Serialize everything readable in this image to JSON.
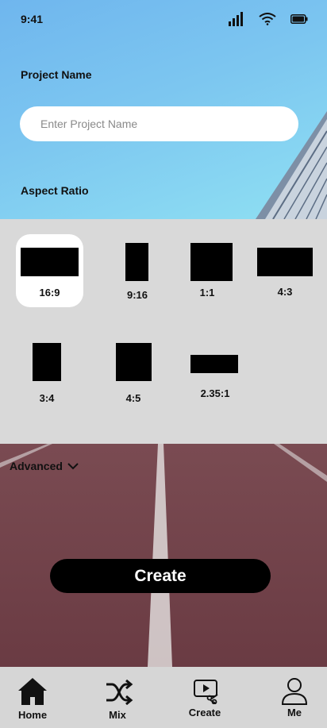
{
  "status": {
    "time": "9:41"
  },
  "form": {
    "project_name_label": "Project Name",
    "project_name_placeholder": "Enter Project Name",
    "aspect_ratio_label": "Aspect Ratio"
  },
  "aspect_ratios": [
    {
      "label": "16:9",
      "selected": true
    },
    {
      "label": "9:16",
      "selected": false
    },
    {
      "label": "1:1",
      "selected": false
    },
    {
      "label": "4:3",
      "selected": false
    },
    {
      "label": "3:4",
      "selected": false
    },
    {
      "label": "4:5",
      "selected": false
    },
    {
      "label": "2.35:1",
      "selected": false
    }
  ],
  "advanced": {
    "label": "Advanced"
  },
  "create_button": {
    "label": "Create"
  },
  "nav": {
    "items": [
      {
        "label": "Home",
        "icon": "home-icon"
      },
      {
        "label": "Mix",
        "icon": "shuffle-icon"
      },
      {
        "label": "Create",
        "icon": "video-create-icon"
      },
      {
        "label": "Me",
        "icon": "person-icon"
      }
    ]
  }
}
